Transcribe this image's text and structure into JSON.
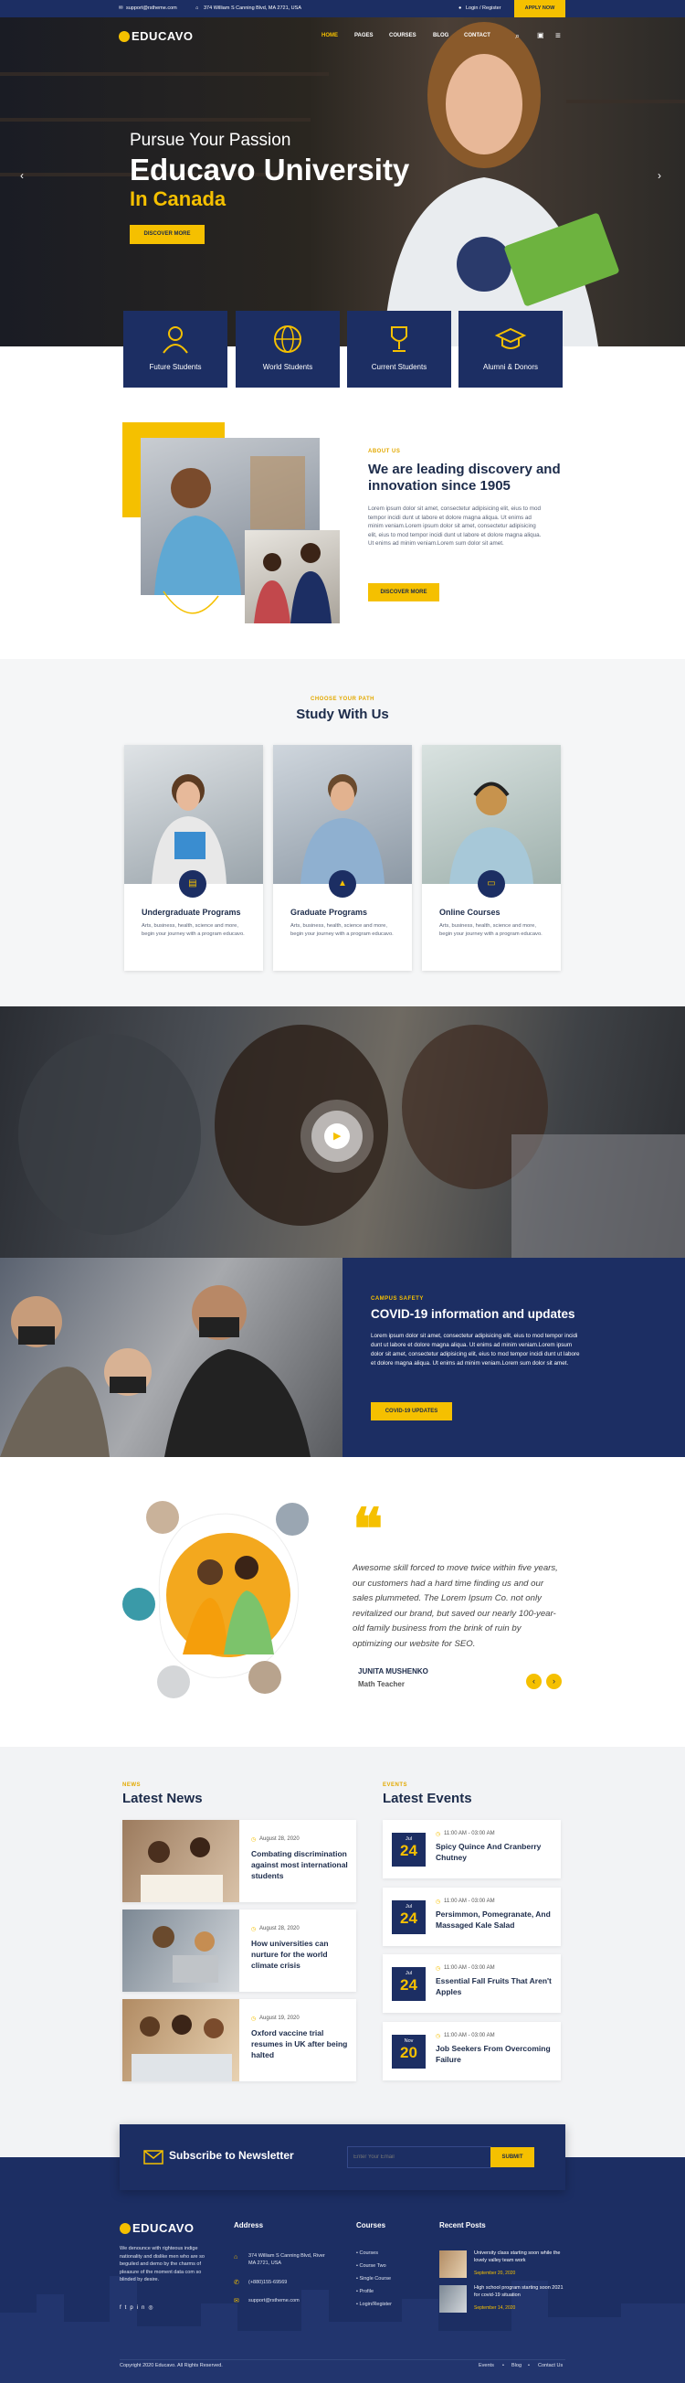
{
  "topbar": {
    "email": "support@rstheme.com",
    "address": "374 William S Canning Blvd, MA 2721, USA",
    "login": "Login / Register",
    "apply": "APPLY NOW"
  },
  "nav": {
    "logo": "EDUCAVO",
    "items": [
      "HOME",
      "PAGES",
      "COURSES",
      "BLOG",
      "CONTACT"
    ]
  },
  "hero": {
    "pre": "Pursue Your Passion",
    "title": "Educavo University",
    "sub": "In Canada",
    "button": "DISCOVER MORE"
  },
  "categories": [
    "Future Students",
    "World Students",
    "Current Students",
    "Alumni & Donors"
  ],
  "about": {
    "kicker": "ABOUT US",
    "title_line1": "We are leading discovery and",
    "title_line2": "innovation since 1905",
    "body": "Lorem ipsum dolor sit amet, consectetur adipisicing elit, eius to mod tempor incidi dunt ut labore et dolore magna aliqua. Ut enims ad minim veniam.Lorem ipsum dolor sit amet, consectetur adipisicing elit, eius to mod tempor incidi dunt ut labore et dolore magna aliqua. Ut enims ad minim veniam.Lorem sum dolor sit amet.",
    "button": "DISCOVER MORE"
  },
  "study": {
    "kicker": "CHOOSE YOUR PATH",
    "title": "Study With Us",
    "cards": [
      {
        "title": "Undergraduate Programs",
        "desc": "Arts, business, health, science and more, begin your journey with a program educavo."
      },
      {
        "title": "Graduate Programs",
        "desc": "Arts, business, health, science and more, begin your journey with a program educavo."
      },
      {
        "title": "Online Courses",
        "desc": "Arts, business, health, science and more, begin your journey with a program educavo."
      }
    ]
  },
  "covid": {
    "kicker": "CAMPUS SAFETY",
    "title": "COVID-19 information and updates",
    "body": "Lorem ipsum dolor sit amet, consectetur adipisicing elit, eius to mod tempor incidi dunt ut labore et dolore magna aliqua. Ut enims ad minim veniam.Lorem ipsum dolor sit amet, consectetur adipisicing elit, eius to mod tempor incidi dunt ut labore et dolore magna aliqua. Ut enims ad minim veniam.Lorem sum dolor sit amet.",
    "button": "COVID-19 UPDATES"
  },
  "testimonial": {
    "quote": "Awesome skill forced to move twice within five years, our customers had a hard time finding us and our sales plummeted. The Lorem Ipsum Co. not only revitalized our brand, but saved our nearly 100-year-old family business from the brink of ruin by optimizing our website for SEO.",
    "name": "JUNITA MUSHENKO",
    "role": "Math Teacher"
  },
  "news": {
    "kicker": "NEWS",
    "title": "Latest News",
    "items": [
      {
        "date": "August 28, 2020",
        "title": "Combating discrimination against most international students"
      },
      {
        "date": "August 28, 2020",
        "title": "How universities can nurture for the world climate crisis"
      },
      {
        "date": "August 19, 2020",
        "title": "Oxford vaccine trial resumes in UK after being halted"
      }
    ]
  },
  "events": {
    "kicker": "EVENTS",
    "title": "Latest Events",
    "items": [
      {
        "month": "Jul",
        "day": "24",
        "time": "11:00 AM - 03:00 AM",
        "title": "Spicy Quince And Cranberry Chutney"
      },
      {
        "month": "Jul",
        "day": "24",
        "time": "11:00 AM - 03:00 AM",
        "title": "Persimmon, Pomegranate, And Massaged Kale Salad"
      },
      {
        "month": "Jul",
        "day": "24",
        "time": "11:00 AM - 03:00 AM",
        "title": "Essential Fall Fruits That Aren't Apples"
      },
      {
        "month": "Nov",
        "day": "20",
        "time": "11:00 AM - 03:00 AM",
        "title": "Job Seekers From Overcoming Failure"
      }
    ]
  },
  "newsletter": {
    "title": "Subscribe to Newsletter",
    "placeholder": "Enter Your Email",
    "button": "SUBMIT"
  },
  "footer": {
    "logo": "EDUCAVO",
    "about": "We denounce with righteous indige nationality and dislike men who are so beguiled and demo by the charms of pleasure of the moment data com so blinded by desire.",
    "address_title": "Address",
    "address": "374 William S Canning Blvd, River MA 2721, USA",
    "phone": "(+880)155-69569",
    "email": "support@rstheme.com",
    "courses_title": "Courses",
    "courses": [
      "Courses",
      "Course Two",
      "Single Course",
      "Profile",
      "Login/Register"
    ],
    "posts_title": "Recent Posts",
    "posts": [
      {
        "title": "University class starting soon while the lovely valley team work",
        "date": "September 20, 2020"
      },
      {
        "title": "High school program starting soon 2021 for covid-19 situation",
        "date": "September 14, 2020"
      }
    ],
    "copyright": "Copyright 2020 Educavo. All Rights Reserved.",
    "links": [
      "Events",
      "Blog",
      "Contact Us"
    ]
  },
  "colors": {
    "navy": "#1c2e63",
    "yellow": "#f5c000"
  }
}
